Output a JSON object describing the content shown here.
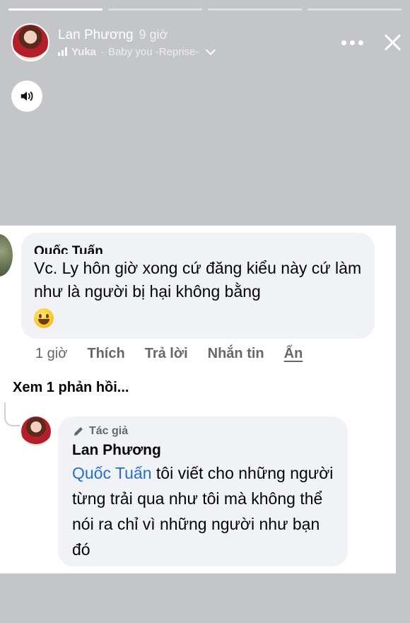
{
  "story": {
    "user_name": "Lan Phương",
    "time_ago": "9 giờ",
    "music_artist": "Yuka",
    "music_separator": "·",
    "music_title": "Baby you -Reprise-"
  },
  "comment": {
    "author": "Quốc Tuấn",
    "text": "Vc. Ly hôn giờ xong cứ đăng kiểu này cứ làm như là người bị hại không bằng",
    "actions": {
      "time": "1 giờ",
      "like": "Thích",
      "reply": "Trả lời",
      "message": "Nhắn tin",
      "hide": "Ẩn"
    },
    "view_replies": "Xem 1 phản hồi..."
  },
  "reply": {
    "badge": "Tác giả",
    "author": "Lan Phương",
    "mention": "Quốc Tuấn",
    "text": " tôi viết cho những người từng trải qua như tôi mà không thể nói ra chỉ vì những người như bạn đó"
  },
  "colors": {
    "background": "#c4c5c8",
    "bubble": "#f0f2f5",
    "mention": "#216fdb",
    "secondary_text": "#65676b"
  },
  "icons": [
    "sound-icon",
    "more-icon",
    "close-icon",
    "music-bars-icon",
    "chevron-down-icon",
    "pencil-icon",
    "emoji-grin-icon"
  ]
}
